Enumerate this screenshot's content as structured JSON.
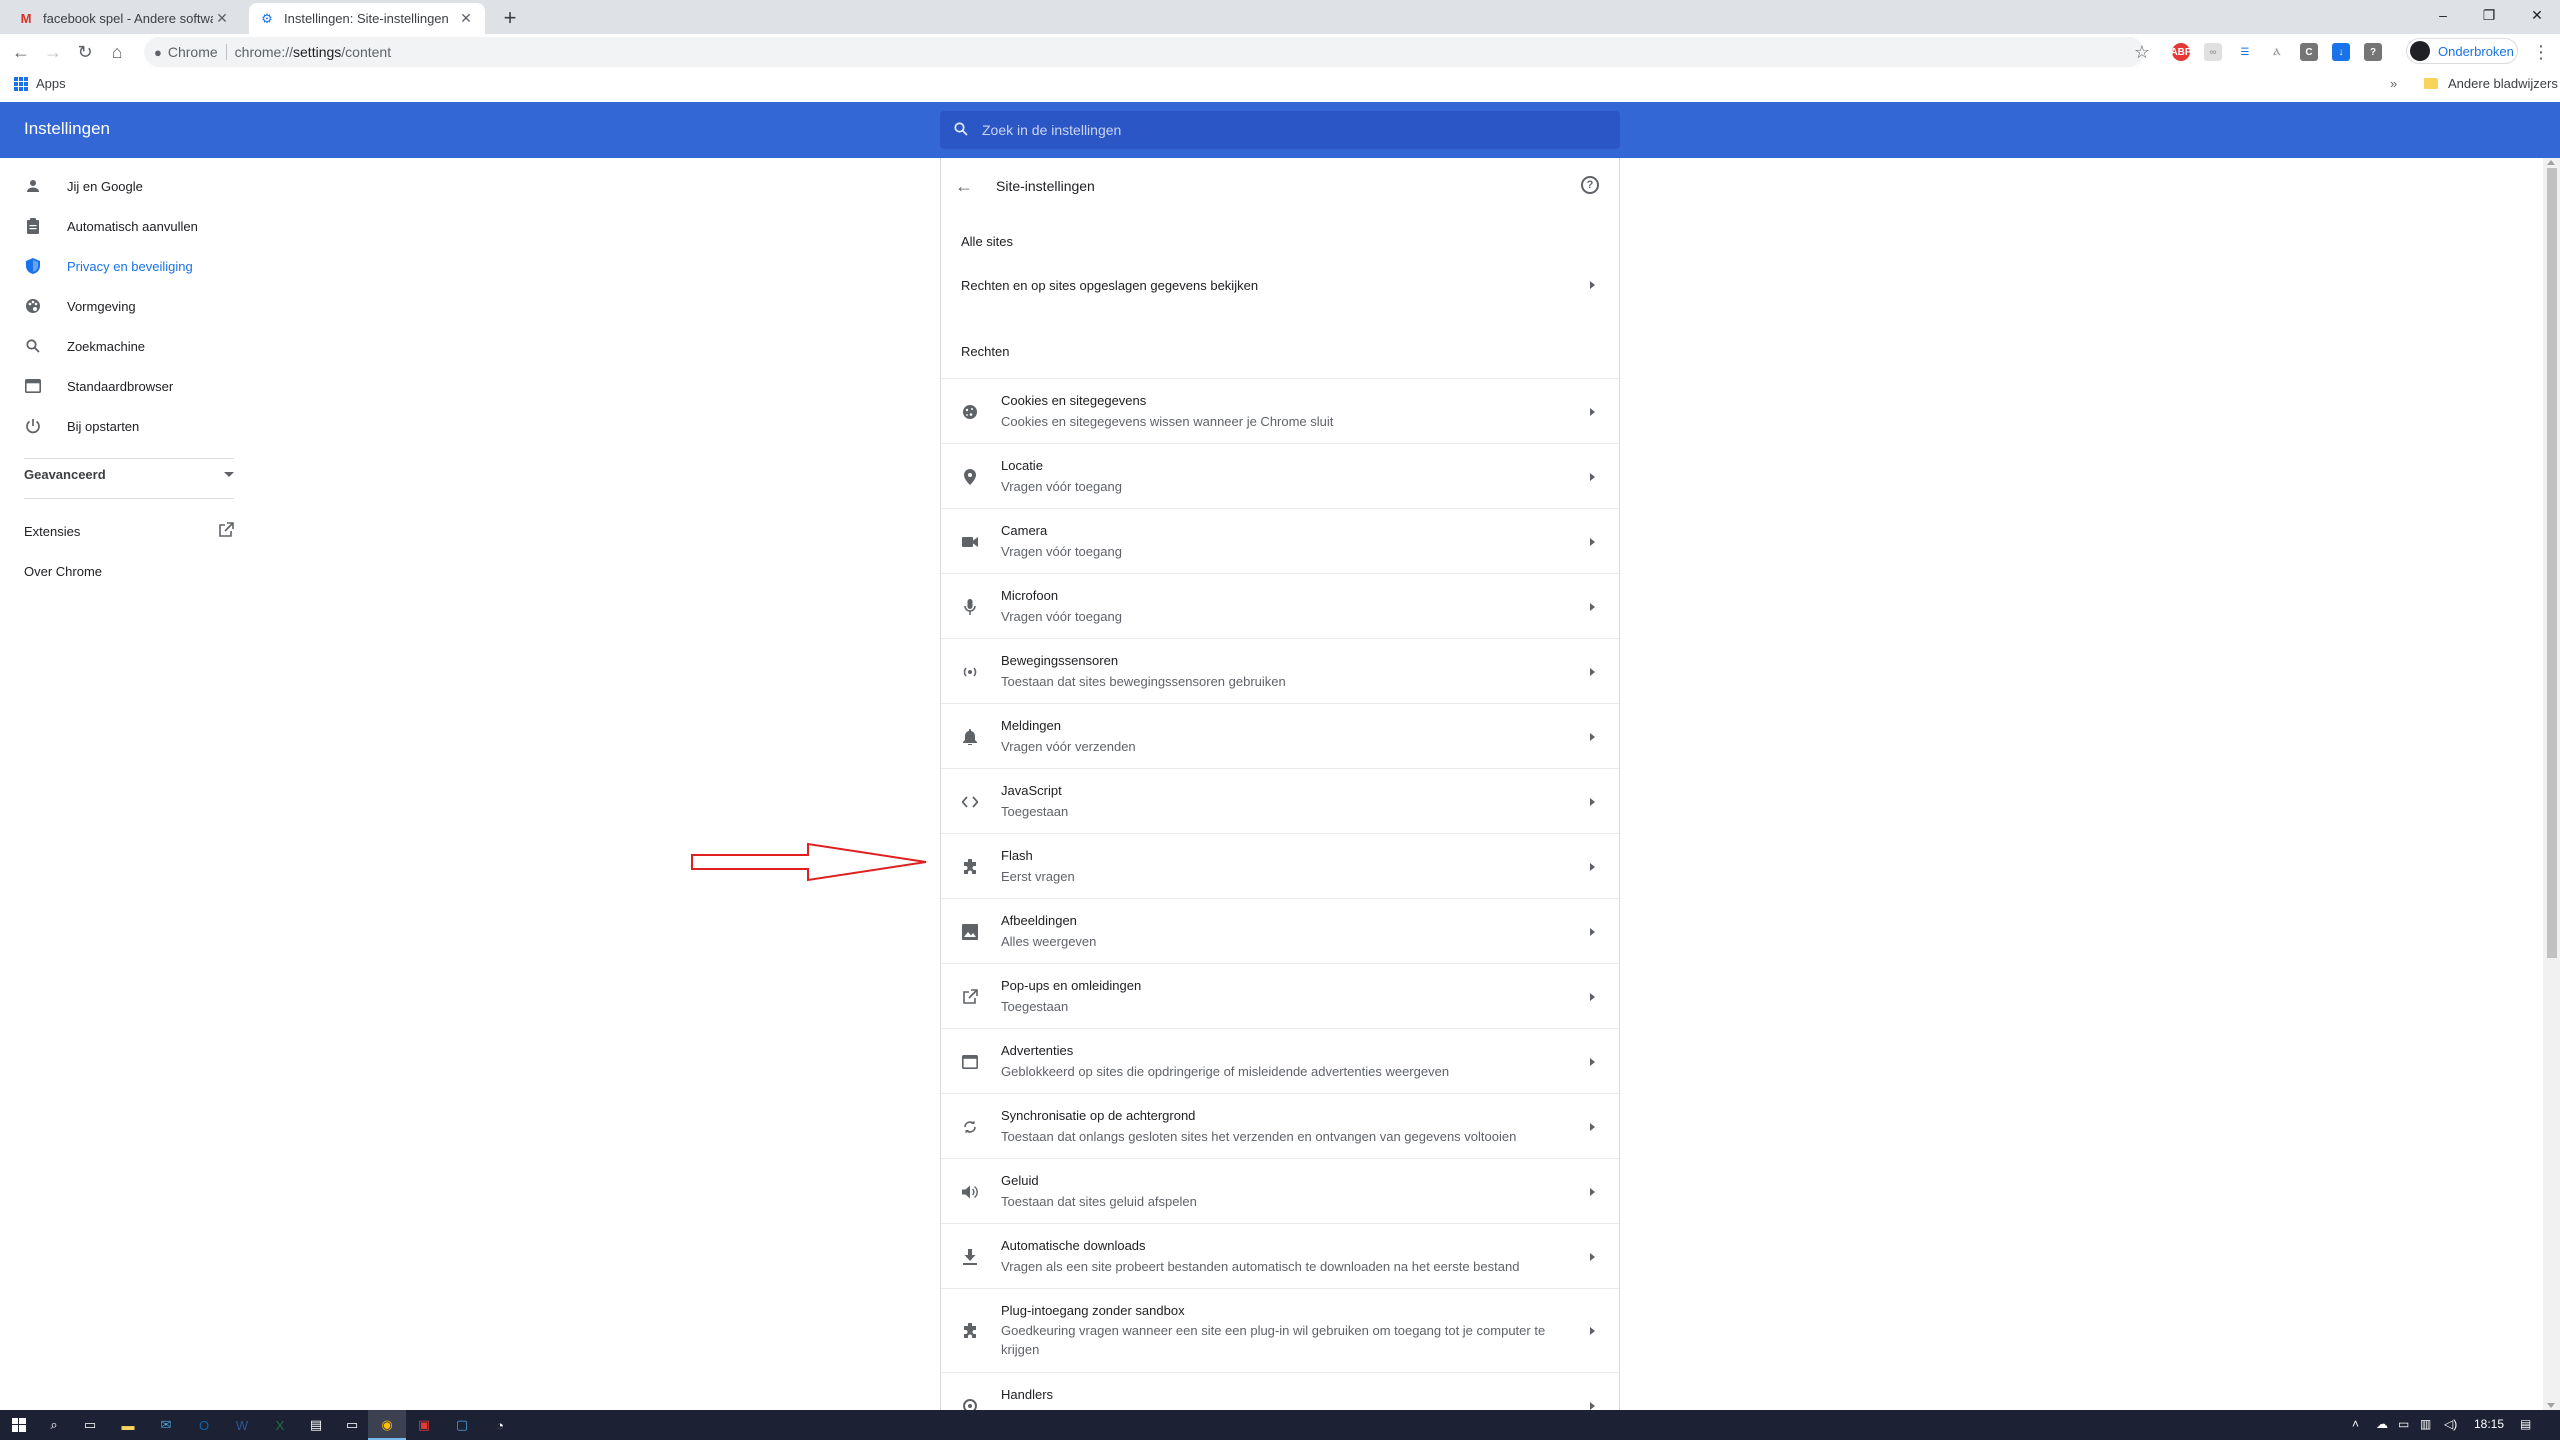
{
  "tabs": [
    {
      "title": "facebook spel - Andere software",
      "active": false
    },
    {
      "title": "Instellingen: Site-instellingen",
      "active": true
    }
  ],
  "omnibox": {
    "scheme": "Chrome",
    "url_prefix": "chrome://",
    "url_path": "settings",
    "url_suffix": "/content"
  },
  "profile": {
    "label": "Onderbroken"
  },
  "bookmarks": {
    "apps": "Apps",
    "other": "Andere bladwijzers"
  },
  "header": {
    "title": "Instellingen",
    "search_placeholder": "Zoek in de instellingen"
  },
  "sidebar": {
    "items": [
      {
        "label": "Jij en Google",
        "icon": "person-icon"
      },
      {
        "label": "Automatisch aanvullen",
        "icon": "clipboard-icon"
      },
      {
        "label": "Privacy en beveiliging",
        "icon": "shield-icon",
        "selected": true
      },
      {
        "label": "Vormgeving",
        "icon": "palette-icon"
      },
      {
        "label": "Zoekmachine",
        "icon": "search-icon"
      },
      {
        "label": "Standaardbrowser",
        "icon": "browser-icon"
      },
      {
        "label": "Bij opstarten",
        "icon": "power-icon"
      }
    ],
    "advanced": "Geavanceerd",
    "extensions": "Extensies",
    "about": "Over Chrome"
  },
  "content": {
    "title": "Site-instellingen",
    "all_sites_label": "Alle sites",
    "all_sites_row": "Rechten en op sites opgeslagen gegevens bekijken",
    "permissions_label": "Rechten",
    "permissions": [
      {
        "name": "Cookies en sitegegevens",
        "sub": "Cookies en sitegegevens wissen wanneer je Chrome sluit",
        "icon": "cookie-icon"
      },
      {
        "name": "Locatie",
        "sub": "Vragen vóór toegang",
        "icon": "location-pin-icon"
      },
      {
        "name": "Camera",
        "sub": "Vragen vóór toegang",
        "icon": "camera-icon"
      },
      {
        "name": "Microfoon",
        "sub": "Vragen vóór toegang",
        "icon": "microphone-icon"
      },
      {
        "name": "Bewegingssensoren",
        "sub": "Toestaan dat sites bewegingssensoren gebruiken",
        "icon": "sensors-icon"
      },
      {
        "name": "Meldingen",
        "sub": "Vragen vóór verzenden",
        "icon": "bell-icon"
      },
      {
        "name": "JavaScript",
        "sub": "Toegestaan",
        "icon": "code-icon"
      },
      {
        "name": "Flash",
        "sub": "Eerst vragen",
        "icon": "puzzle-icon"
      },
      {
        "name": "Afbeeldingen",
        "sub": "Alles weergeven",
        "icon": "image-icon"
      },
      {
        "name": "Pop-ups en omleidingen",
        "sub": "Toegestaan",
        "icon": "open-in-new-icon"
      },
      {
        "name": "Advertenties",
        "sub": "Geblokkeerd op sites die opdringerige of misleidende advertenties weergeven",
        "icon": "ads-icon"
      },
      {
        "name": "Synchronisatie op de achtergrond",
        "sub": "Toestaan dat onlangs gesloten sites het verzenden en ontvangen van gegevens voltooien",
        "icon": "sync-icon"
      },
      {
        "name": "Geluid",
        "sub": "Toestaan dat sites geluid afspelen",
        "icon": "speaker-icon"
      },
      {
        "name": "Automatische downloads",
        "sub": "Vragen als een site probeert bestanden automatisch te downloaden na het eerste bestand",
        "icon": "download-icon"
      },
      {
        "name": "Plug-intoegang zonder sandbox",
        "sub": "Goedkeuring vragen wanneer een site een plug-in wil gebruiken om toegang tot je computer te krijgen",
        "icon": "puzzle-icon"
      },
      {
        "name": "Handlers",
        "sub": "",
        "icon": "handler-icon"
      }
    ]
  },
  "taskbar": {
    "time": "18:15"
  },
  "colors": {
    "header_blue": "#3367d6",
    "accent": "#1a73e8",
    "annotation_arrow": "#e02020"
  }
}
